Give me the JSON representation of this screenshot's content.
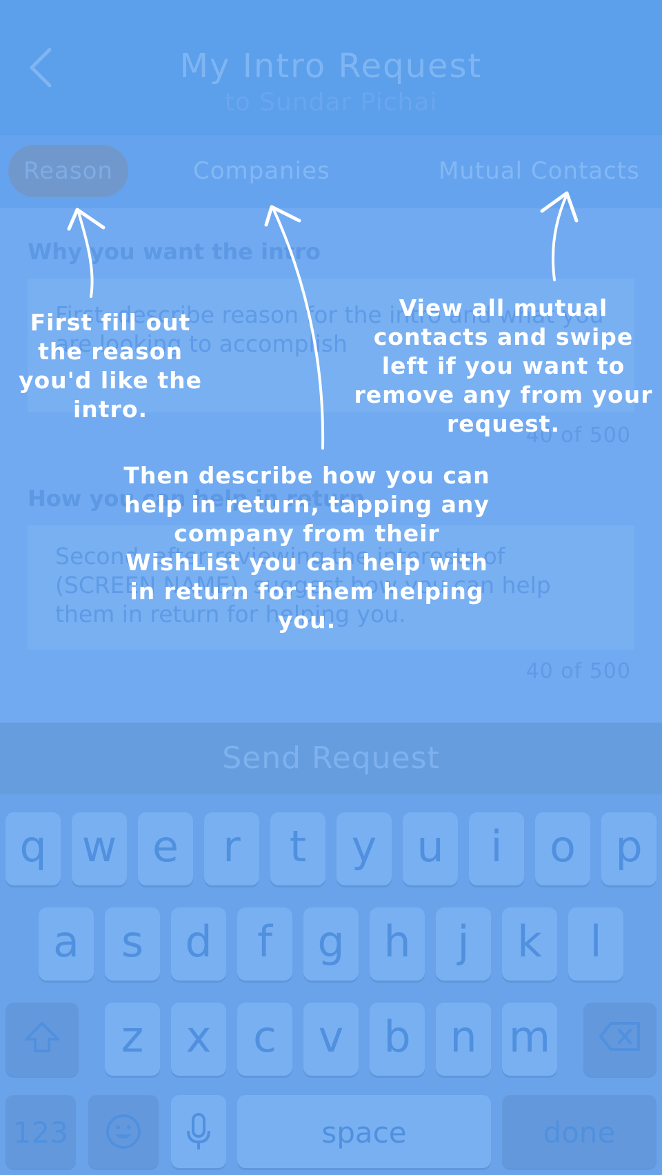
{
  "header": {
    "title": "My Intro Request",
    "subtitle": "to Sundar Pichai"
  },
  "tabs": [
    {
      "label": "Reason",
      "active": true
    },
    {
      "label": "Companies",
      "active": false
    },
    {
      "label": "Mutual Contacts",
      "active": false
    }
  ],
  "form": {
    "reason": {
      "label": "Why you want the intro",
      "placeholder": "First, describe reason for the intro and what you are looking to accomplish",
      "counter": "40 of 500"
    },
    "help": {
      "label": "How you can help in return",
      "placeholder": "Second, after reviewing the interests of (SCREEN NAME), suggest how you can help them in return for helping you.",
      "counter": "40 of 500"
    }
  },
  "send_button": "Send Request",
  "keyboard": {
    "row1": [
      "q",
      "w",
      "e",
      "r",
      "t",
      "y",
      "u",
      "i",
      "o",
      "p"
    ],
    "row2": [
      "a",
      "s",
      "d",
      "f",
      "g",
      "h",
      "j",
      "k",
      "l"
    ],
    "row3": [
      "z",
      "x",
      "c",
      "v",
      "b",
      "n",
      "m"
    ],
    "numbers": "123",
    "space": "space",
    "done": "done"
  },
  "coach_marks": {
    "reason": "First fill out the reason you'd like the intro.",
    "companies": "Then describe how you can help in return, tapping any company from their WishList you can help with in return for them helping you.",
    "mutual": "View all mutual contacts and swipe left if you want to remove any from your request."
  },
  "colors": {
    "background": "#71aaf0",
    "header": "#5c9feb",
    "overlay_text": "#ffffff"
  }
}
